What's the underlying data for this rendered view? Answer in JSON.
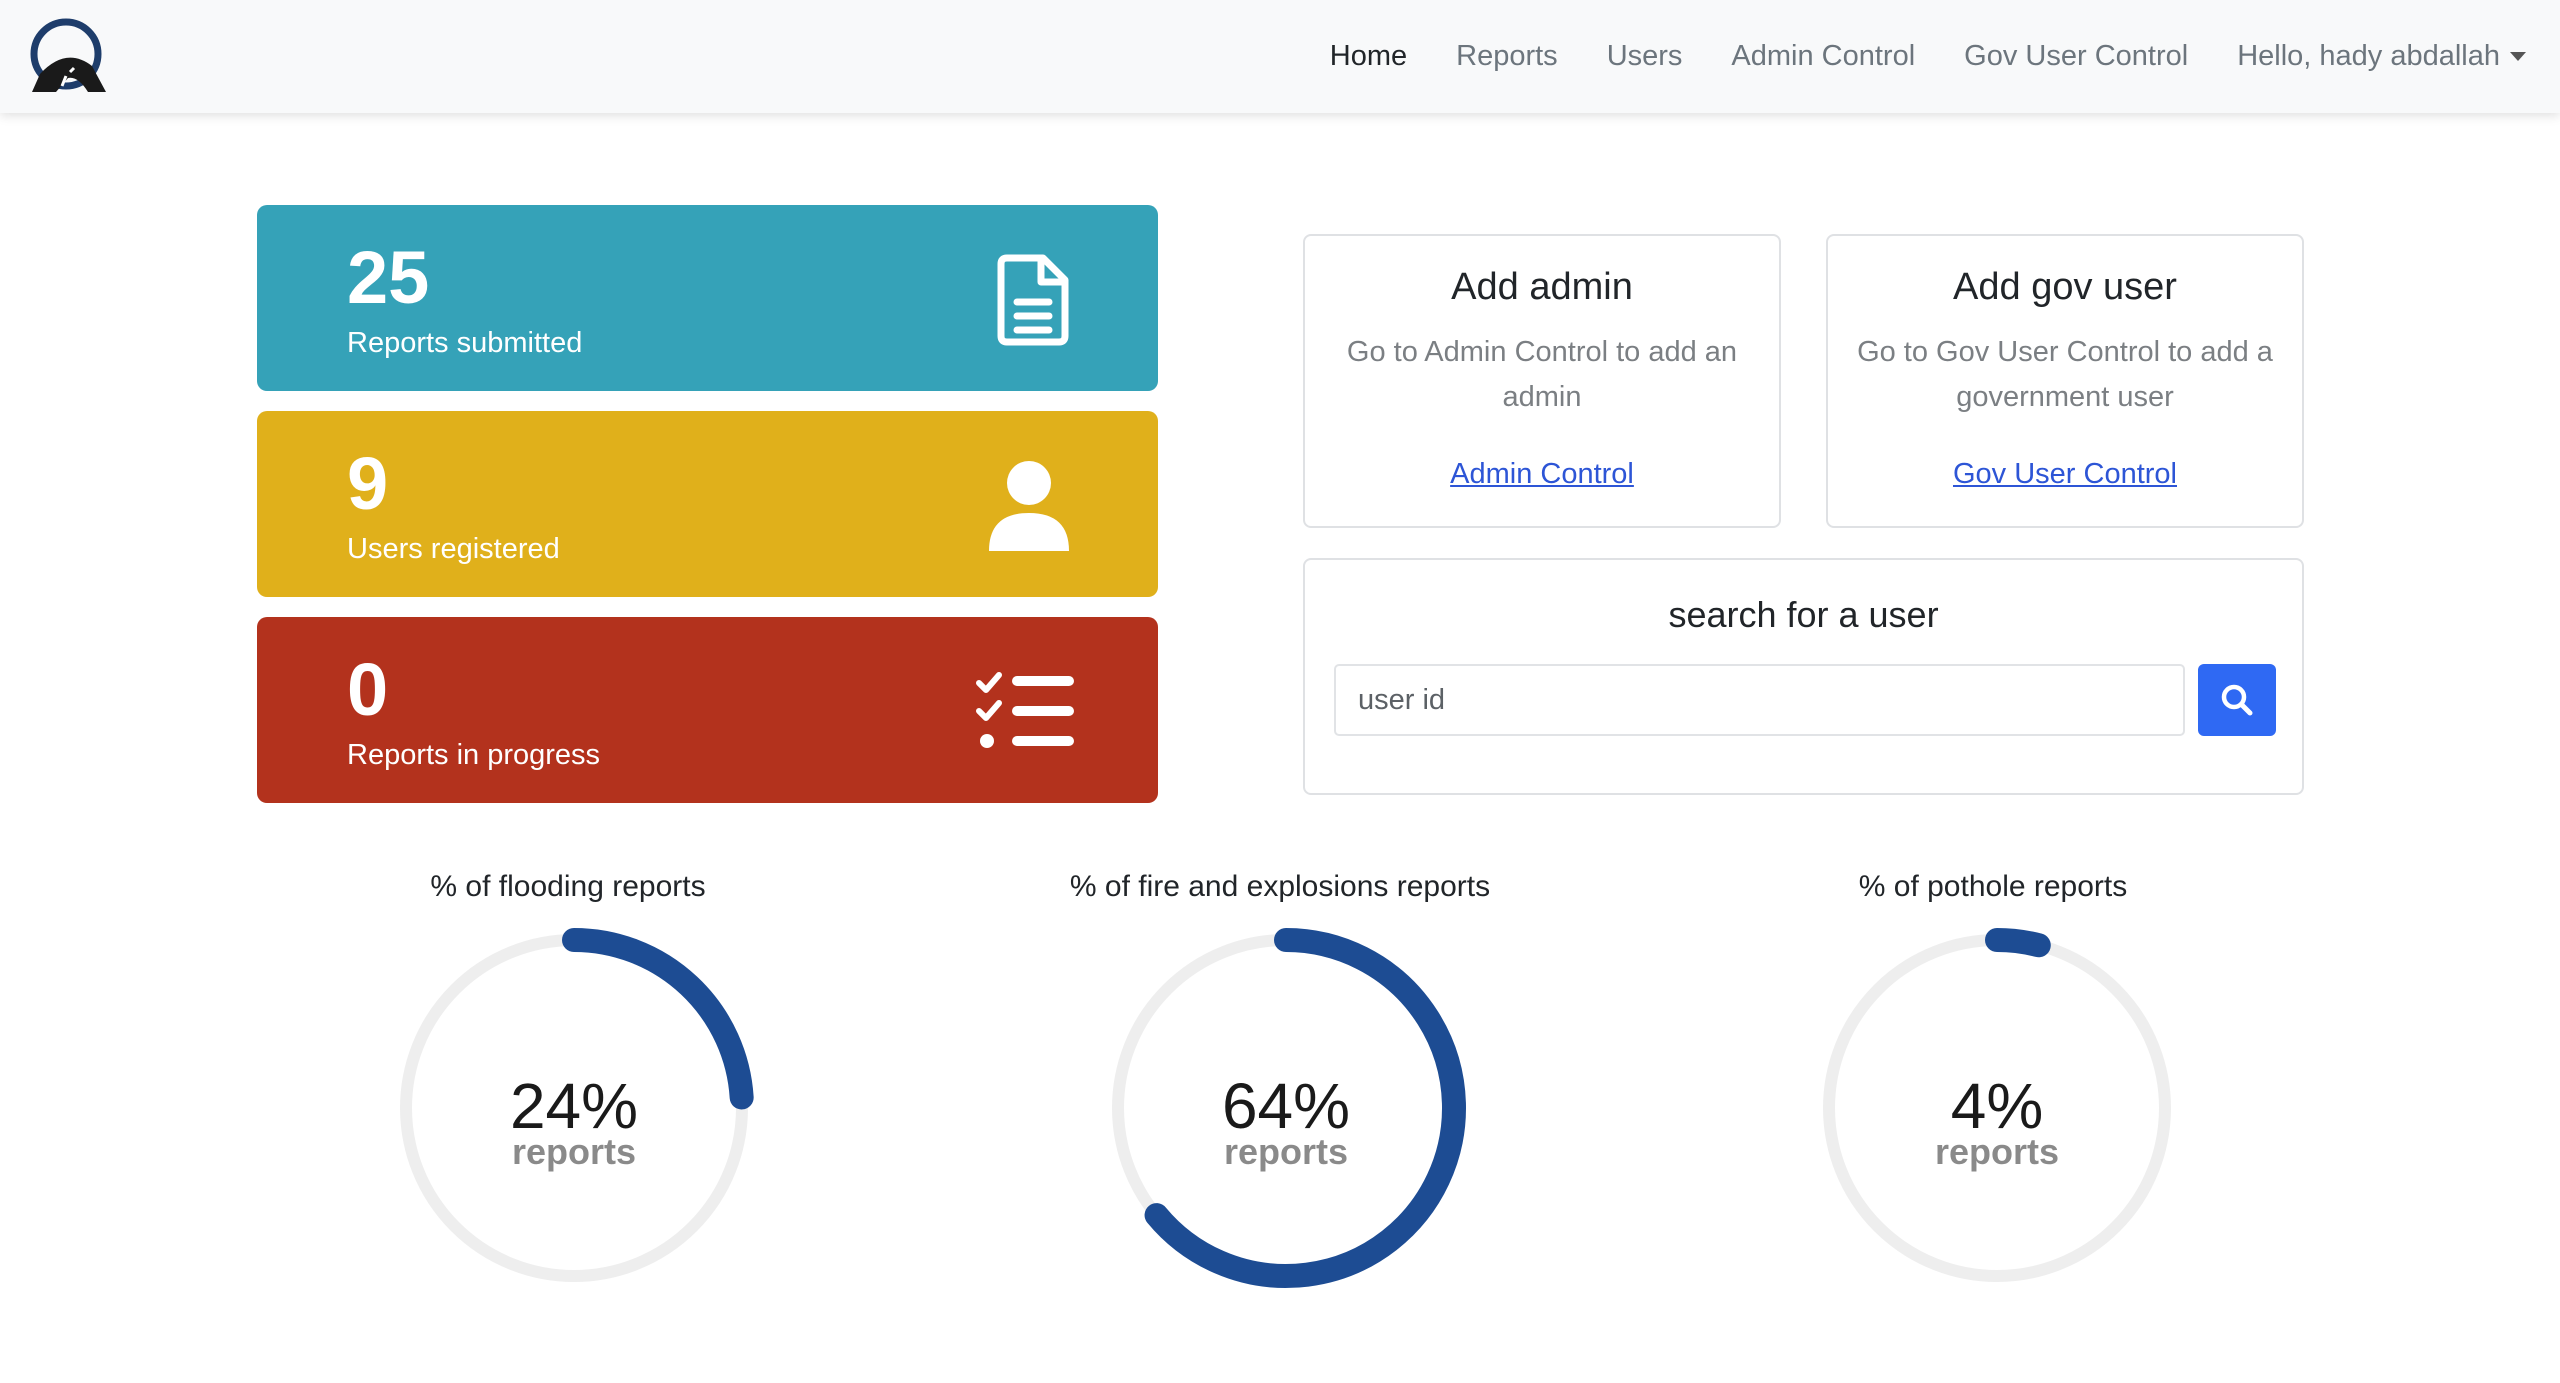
{
  "nav": {
    "items": [
      {
        "label": "Home",
        "active": true
      },
      {
        "label": "Reports"
      },
      {
        "label": "Users"
      },
      {
        "label": "Admin Control"
      },
      {
        "label": "Gov User Control"
      }
    ],
    "user_greeting": "Hello, hady abdallah"
  },
  "stats": [
    {
      "value": "25",
      "label": "Reports submitted",
      "color": "#35a2b8",
      "icon": "document-icon"
    },
    {
      "value": "9",
      "label": "Users registered",
      "color": "#e0b01b",
      "icon": "user-icon"
    },
    {
      "value": "0",
      "label": "Reports in progress",
      "color": "#b3321d",
      "icon": "checklist-icon"
    }
  ],
  "add_admin": {
    "title": "Add admin",
    "description": "Go to Admin Control to add an admin",
    "link": "Admin Control"
  },
  "add_gov_user": {
    "title": "Add gov user",
    "description": "Go to Gov User Control to add a government user",
    "link": "Gov User Control"
  },
  "search": {
    "title": "search for a user",
    "placeholder": "user id"
  },
  "gauges": [
    {
      "title": "% of flooding reports",
      "percent": 24,
      "value_text": "24%",
      "caption": "reports"
    },
    {
      "title": "% of fire and explosions reports",
      "percent": 64,
      "value_text": "64%",
      "caption": "reports"
    },
    {
      "title": "% of pothole reports",
      "percent": 4,
      "value_text": "4%",
      "caption": "reports"
    }
  ],
  "colors": {
    "gauge_fill": "#1d4c93",
    "gauge_track": "#eeeeee",
    "search_button": "#2f69f3",
    "link": "#2d55d6"
  }
}
